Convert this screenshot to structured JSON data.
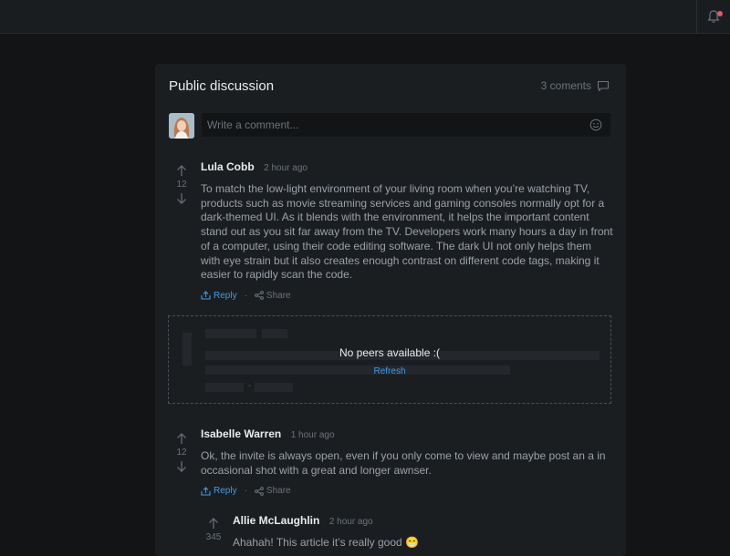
{
  "header": {
    "notification_icon": "bell-icon",
    "has_unread": true
  },
  "discussion": {
    "title": "Public discussion",
    "comment_count": "3 coments",
    "input_placeholder": "Write a comment..."
  },
  "comments": [
    {
      "author": "Lula Cobb",
      "time": "2 hour ago",
      "votes": "12",
      "body": "To match the low-light environment of your living room when you’re watching TV, products such as movie streaming services and gaming consoles normally opt for a dark-themed UI. As it blends with the environment, it helps the important content stand out as you sit far away from the TV. Developers work many hours a day in front of a computer, using their code editing software. The dark UI not only helps them with eye strain but it also creates enough contrast on different code tags, making it easier to rapidly scan the code.",
      "reply_label": "Reply",
      "separator": "·",
      "share_label": "Share"
    },
    {
      "author": "Isabelle Warren",
      "time": "1 hour ago",
      "votes": "12",
      "body": "Ok, the invite is always open, even if you only come to view and maybe post an a in occasional shot with a great and longer awnser.",
      "reply_label": "Reply",
      "separator": "·",
      "share_label": "Share"
    },
    {
      "author": "Allie McLaughlin",
      "time": "2 hour ago",
      "votes": "345",
      "body": "Ahahah! This article it’s really good 😁"
    }
  ],
  "peers": {
    "title": "No peers available :(",
    "refresh_label": "Refresh",
    "separator": "-"
  },
  "colors": {
    "accent": "#3d9be9",
    "badge": "#e8566c",
    "background": "#121416",
    "card": "#1b1e21"
  }
}
